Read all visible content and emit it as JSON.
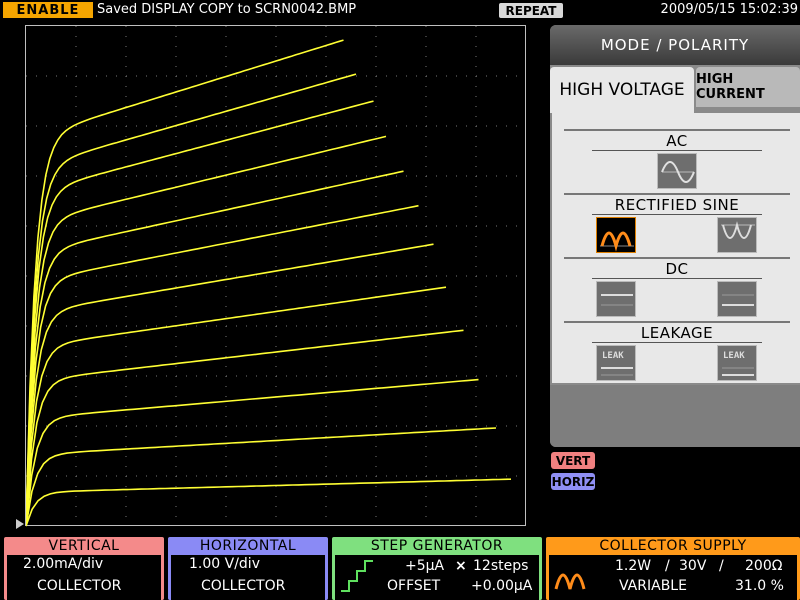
{
  "status_bar": {
    "enable_label": "ENABLE",
    "message": "Saved DISPLAY COPY to SCRN0042.BMP",
    "repeat_label": "REPEAT",
    "datetime": "2009/05/15 15:02:39"
  },
  "panel": {
    "title": "MODE / POLARITY",
    "tab_high_voltage": "HIGH VOLTAGE",
    "tab_high_current": "HIGH CURRENT",
    "section_ac": "AC",
    "section_rectified": "RECTIFIED SINE",
    "section_dc": "DC",
    "section_leakage": "LEAKAGE",
    "leak_text": "LEAK"
  },
  "tags": {
    "vert": "VERT",
    "horiz": "HORIZ"
  },
  "readouts": {
    "vertical": {
      "title": "VERTICAL",
      "scale": "2.00mA/div",
      "source": "COLLECTOR"
    },
    "horizontal": {
      "title": "HORIZONTAL",
      "scale": "1.00 V/div",
      "source": "COLLECTOR"
    },
    "step_generator": {
      "title": "STEP GENERATOR",
      "step": "+5µA",
      "times": "×",
      "steps": "12steps",
      "offset_label": "OFFSET",
      "offset_value": "+0.00µA"
    },
    "collector_supply": {
      "title": "COLLECTOR SUPPLY",
      "power": "1.2W",
      "voltage": "30V",
      "resistance": "200Ω",
      "separator": "/",
      "mode": "VARIABLE",
      "percent": "31.0 %"
    }
  },
  "colors": {
    "trace": "#ffff33",
    "enable": "#f5a500",
    "vertical": "#f48a8a",
    "horizontal": "#8a8af5",
    "step": "#7fe07f",
    "collector": "#ff9a1a"
  },
  "chart_data": {
    "type": "line",
    "xlim": [
      0,
      10
    ],
    "ylim": [
      0,
      20
    ],
    "x_unit_per_div": "1.00 V/div",
    "y_unit_per_div": "2.00mA/div",
    "grid": true,
    "series": [
      {
        "end_x": 9.7,
        "level": 1.35
      },
      {
        "end_x": 9.4,
        "level": 2.85
      },
      {
        "end_x": 9.05,
        "level": 4.3
      },
      {
        "end_x": 8.75,
        "level": 5.8
      },
      {
        "end_x": 8.4,
        "level": 7.15
      },
      {
        "end_x": 8.15,
        "level": 8.5
      },
      {
        "end_x": 7.85,
        "level": 9.75
      },
      {
        "end_x": 7.55,
        "level": 10.9
      },
      {
        "end_x": 7.2,
        "level": 12.1
      },
      {
        "end_x": 6.95,
        "level": 13.3
      },
      {
        "end_x": 6.6,
        "level": 14.3
      },
      {
        "end_x": 6.35,
        "level": 15.5
      }
    ]
  }
}
